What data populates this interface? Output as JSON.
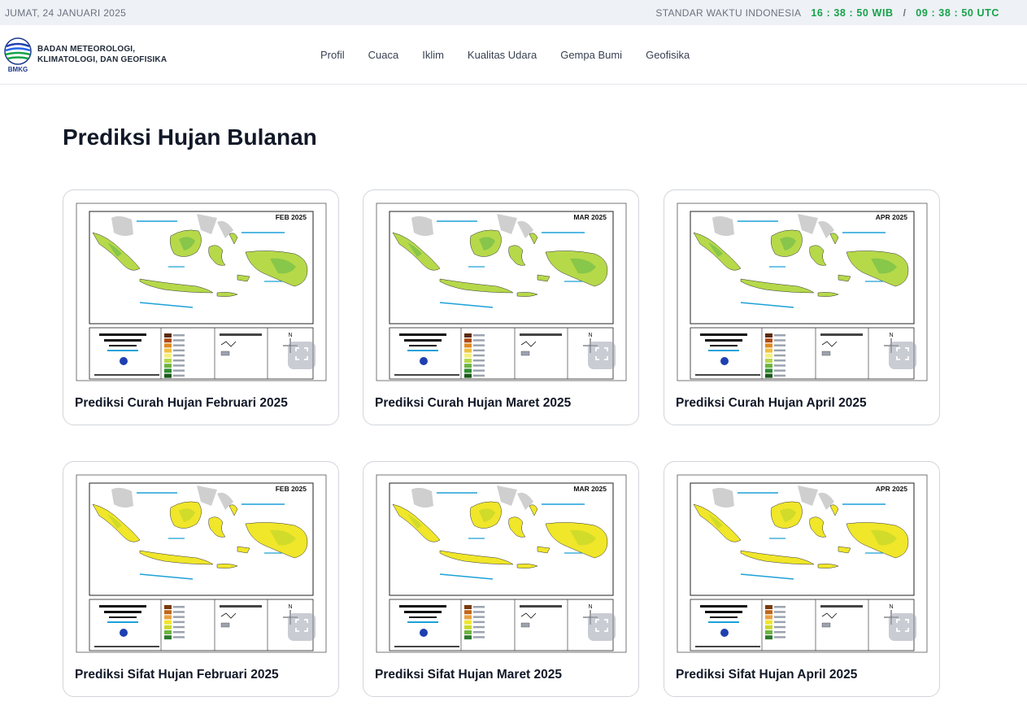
{
  "topbar": {
    "date": "JUMAT, 24 JANUARI 2025",
    "standard_label": "STANDAR WAKTU INDONESIA",
    "wib": "16 : 38 : 50 WIB",
    "separator": "/",
    "utc": "09 : 38 : 50 UTC"
  },
  "brand": {
    "line1": "BADAN METEOROLOGI,",
    "line2": "KLIMATOLOGI, DAN GEOFISIKA",
    "logo_text": "BMKG"
  },
  "nav": [
    "Profil",
    "Cuaca",
    "Iklim",
    "Kualitas Udara",
    "Gempa Bumi",
    "Geofisika"
  ],
  "page_title": "Prediksi Hujan Bulanan",
  "cards": [
    {
      "title": "Prediksi Curah Hujan Februari 2025",
      "map_label": "FEB 2025",
      "kind": "curah"
    },
    {
      "title": "Prediksi Curah Hujan Maret 2025",
      "map_label": "MAR 2025",
      "kind": "curah"
    },
    {
      "title": "Prediksi Curah Hujan April 2025",
      "map_label": "APR 2025",
      "kind": "curah"
    },
    {
      "title": "Prediksi Sifat Hujan Februari 2025",
      "map_label": "FEB 2025",
      "kind": "sifat"
    },
    {
      "title": "Prediksi Sifat Hujan Maret 2025",
      "map_label": "MAR 2025",
      "kind": "sifat"
    },
    {
      "title": "Prediksi Sifat Hujan April 2025",
      "map_label": "APR 2025",
      "kind": "sifat"
    }
  ],
  "colors": {
    "time_green": "#16a34a",
    "curah_land": "#b6d94a",
    "sifat_land": "#f0e62a",
    "sea_text": "#1da1d8"
  }
}
